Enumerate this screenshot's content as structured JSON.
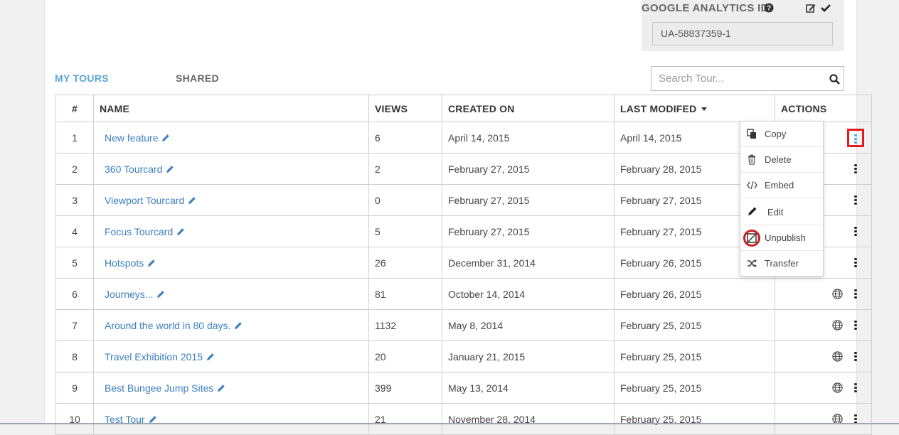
{
  "analytics": {
    "label": "GOOGLE ANALYTICS ID",
    "value": "UA-58837359-1"
  },
  "tabs": {
    "my_tours": "MY TOURS",
    "shared": "SHARED"
  },
  "search": {
    "placeholder": "Search Tour..."
  },
  "table": {
    "headers": {
      "num": "#",
      "name": "NAME",
      "views": "VIEWS",
      "created": "CREATED ON",
      "modified": "LAST MODIFED",
      "actions": "ACTIONS"
    },
    "sorted_by": "LAST MODIFED",
    "rows": [
      {
        "num": "1",
        "name": "New feature",
        "views": "6",
        "created": "April 14, 2015",
        "modified": "April 14, 2015"
      },
      {
        "num": "2",
        "name": "360 Tourcard",
        "views": "2",
        "created": "February 27, 2015",
        "modified": "February 28, 2015"
      },
      {
        "num": "3",
        "name": "Viewport Tourcard",
        "views": "0",
        "created": "February 27, 2015",
        "modified": "February 27, 2015"
      },
      {
        "num": "4",
        "name": "Focus Tourcard",
        "views": "5",
        "created": "February 27, 2015",
        "modified": "February 27, 2015"
      },
      {
        "num": "5",
        "name": "Hotspots",
        "views": "26",
        "created": "December 31, 2014",
        "modified": "February 26, 2015"
      },
      {
        "num": "6",
        "name": "Journeys...",
        "views": "81",
        "created": "October 14, 2014",
        "modified": "February 26, 2015"
      },
      {
        "num": "7",
        "name": "Around the world in 80 days.",
        "views": "1132",
        "created": "May 8, 2014",
        "modified": "February 25, 2015"
      },
      {
        "num": "8",
        "name": "Travel Exhibition 2015",
        "views": "20",
        "created": "January 21, 2015",
        "modified": "February 25, 2015"
      },
      {
        "num": "9",
        "name": "Best Bungee Jump Sites",
        "views": "399",
        "created": "May 13, 2014",
        "modified": "February 25, 2015"
      },
      {
        "num": "10",
        "name": "Test Tour",
        "views": "21",
        "created": "November 28, 2014",
        "modified": "February 25, 2015"
      }
    ]
  },
  "action_menu": {
    "items": [
      {
        "label": "Copy",
        "icon": "copy-icon"
      },
      {
        "label": "Delete",
        "icon": "trash-icon"
      },
      {
        "label": "Embed",
        "icon": "code-icon"
      },
      {
        "label": "Edit",
        "icon": "pencil-icon"
      },
      {
        "label": "Unpublish",
        "icon": "unpublish-icon"
      },
      {
        "label": "Transfer",
        "icon": "shuffle-icon"
      }
    ]
  },
  "colors": {
    "link": "#3b7fc0",
    "active_tab": "#5ba4d8",
    "highlight": "#e01b24"
  }
}
